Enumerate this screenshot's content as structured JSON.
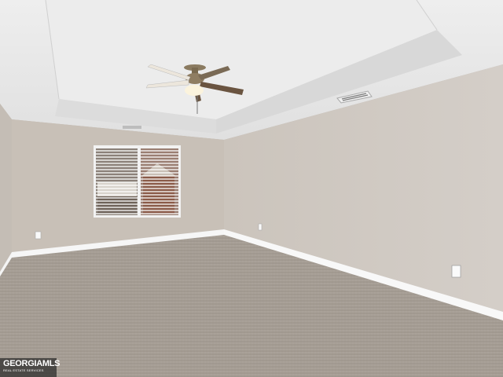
{
  "photo": {
    "subject": "empty bedroom",
    "features": [
      "tray-ceiling",
      "ceiling-fan",
      "window-with-blinds",
      "carpet-floor",
      "baseboards",
      "hvac-vent",
      "outlets"
    ]
  },
  "watermark": {
    "brand": "GEORGIAMLS",
    "subtitle": "REAL ESTATE SERVICES"
  },
  "colors": {
    "ceiling": "#e8e8e8",
    "left_wall": "#c9c2ba",
    "back_wall": "#c6beb5",
    "right_wall": "#d0cac4",
    "carpet": "#a8a097",
    "trim": "#ffffff"
  }
}
